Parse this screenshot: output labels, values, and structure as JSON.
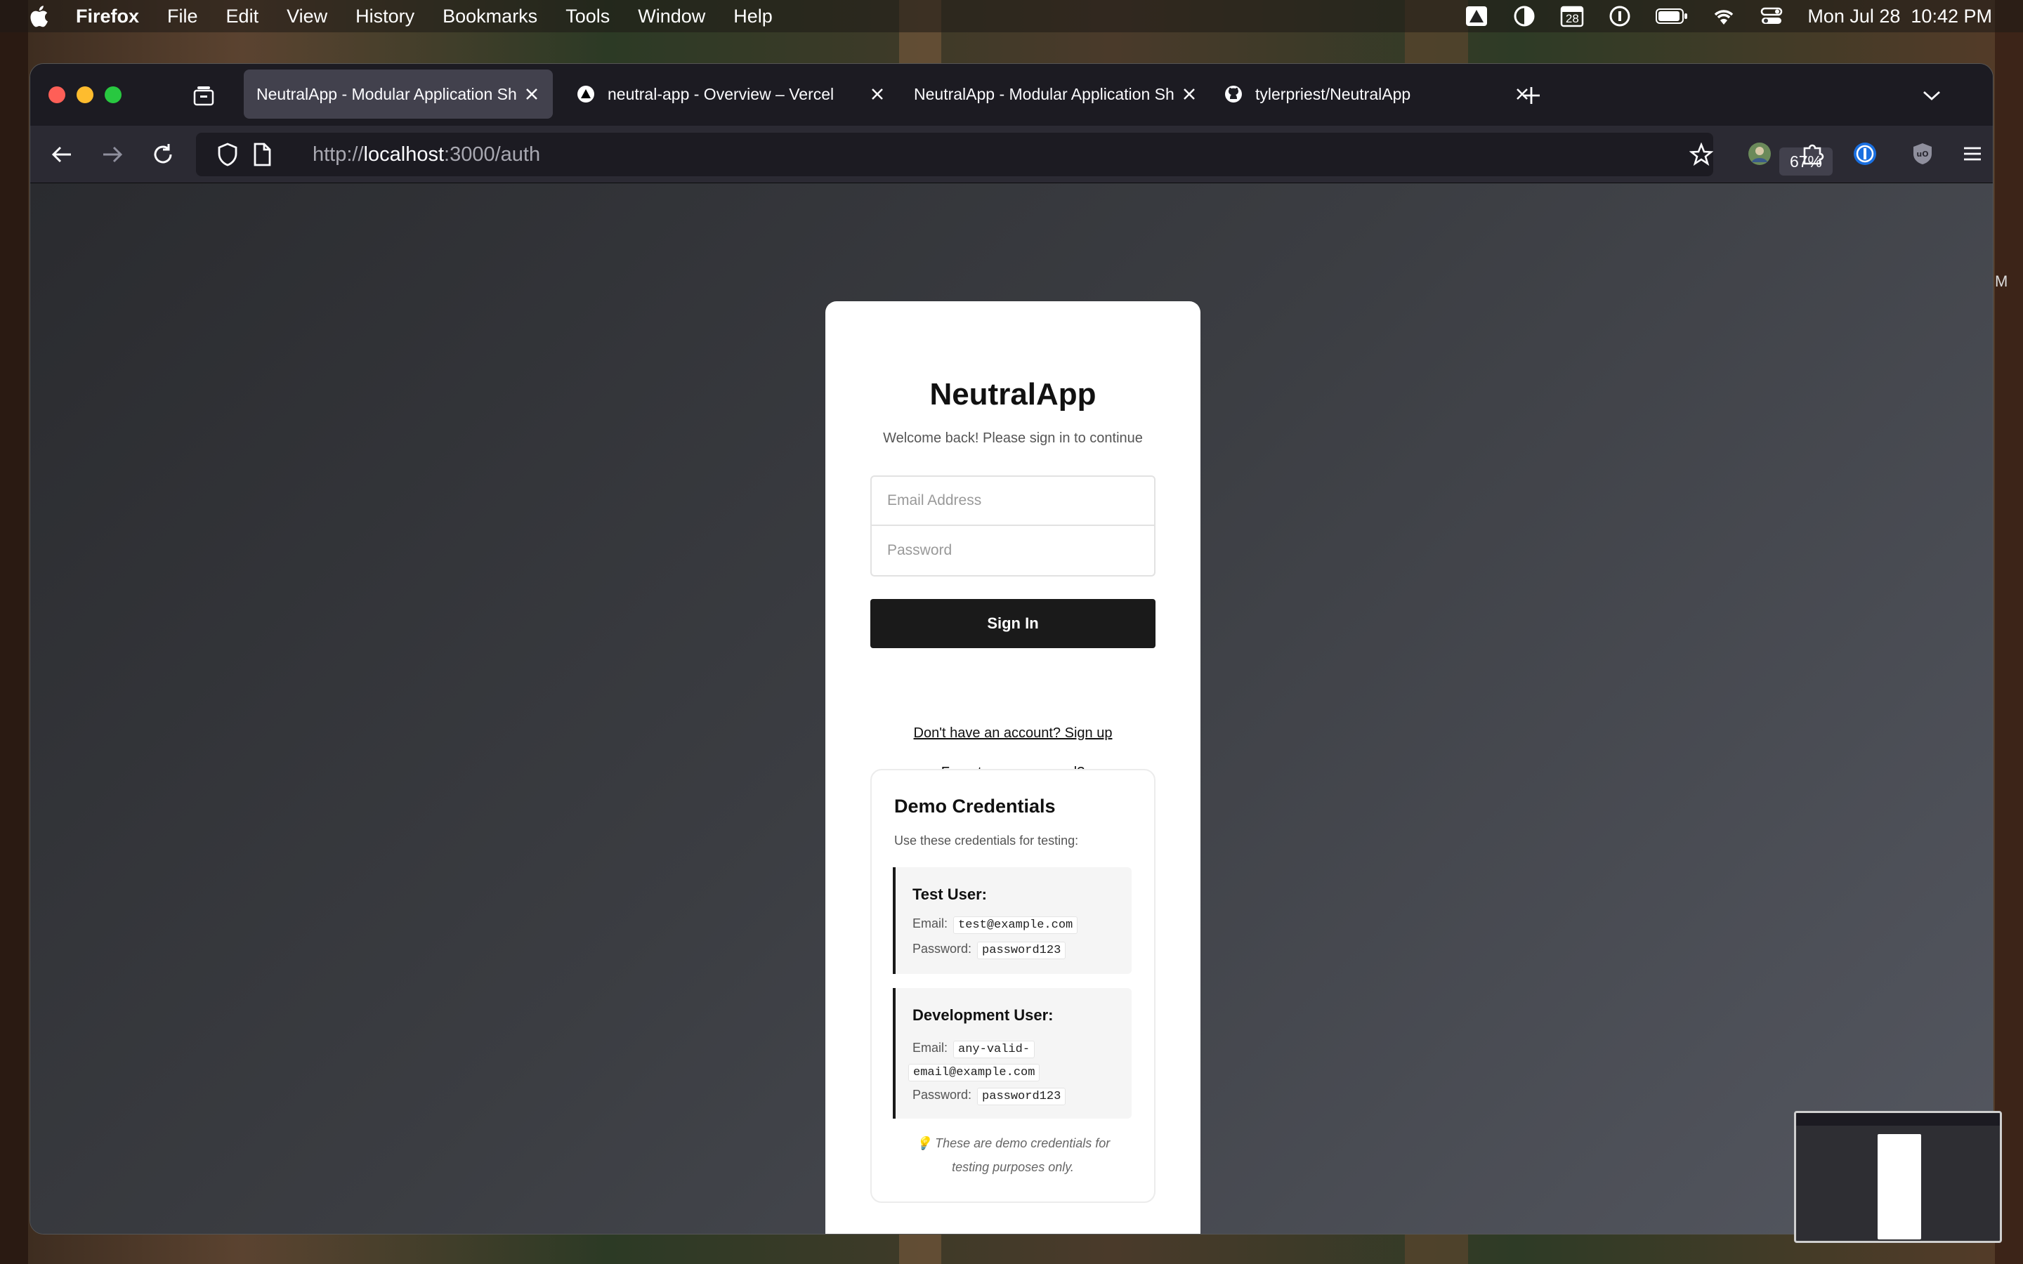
{
  "menubar": {
    "app": "Firefox",
    "items": [
      "File",
      "Edit",
      "View",
      "History",
      "Bookmarks",
      "Tools",
      "Window",
      "Help"
    ],
    "calendar_day": "28",
    "clock": "Mon Jul 28  10:42 PM"
  },
  "tabs": [
    {
      "label": "NeutralApp - Modular Application Sh",
      "favicon": "none",
      "active": true
    },
    {
      "label": "neutral-app - Overview – Vercel",
      "favicon": "vercel-triangle-icon",
      "active": false
    },
    {
      "label": "NeutralApp - Modular Application Sh",
      "favicon": "none",
      "active": false
    },
    {
      "label": "tylerpriest/NeutralApp",
      "favicon": "github-icon",
      "active": false
    }
  ],
  "address": {
    "scheme": "http://",
    "host": "localhost",
    "path": ":3000/auth"
  },
  "zoom": "67%",
  "auth": {
    "title": "NeutralApp",
    "subtitle": "Welcome back! Please sign in to continue",
    "email_placeholder": "Email Address",
    "password_placeholder": "Password",
    "sign_in": "Sign In",
    "signup_link": "Don't have an account? Sign up",
    "forgot_link": "Forgot your password?"
  },
  "demo": {
    "title": "Demo Credentials",
    "subtitle": "Use these credentials for testing:",
    "test_user": {
      "title": "Test User:",
      "email_label": "Email:",
      "email": "test@example.com",
      "password_label": "Password:",
      "password": "password123"
    },
    "dev_user": {
      "title": "Development User:",
      "email_label": "Email:",
      "email_line1": "any-valid-",
      "email_line2": "email@example.com",
      "password_label": "Password:",
      "password": "password123"
    },
    "note_line1": "💡 These are demo credentials for",
    "note_line2": "testing purposes only."
  },
  "edge_letter": "M"
}
